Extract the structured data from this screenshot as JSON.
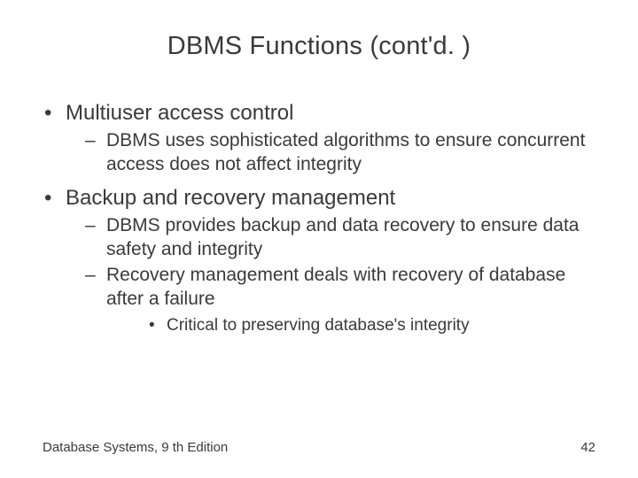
{
  "title": "DBMS Functions (cont'd. )",
  "bullets": [
    {
      "text": "Multiuser access control",
      "children": [
        {
          "text": "DBMS uses sophisticated algorithms to ensure concurrent access does not affect integrity"
        }
      ]
    },
    {
      "text": "Backup and recovery management",
      "children": [
        {
          "text": "DBMS provides backup and data recovery to ensure data safety and integrity"
        },
        {
          "text": "Recovery management deals with recovery of database after a failure",
          "children": [
            {
              "text": "Critical to preserving database's integrity"
            }
          ]
        }
      ]
    }
  ],
  "footer": {
    "left": "Database Systems, 9 th Edition",
    "right": "42"
  }
}
